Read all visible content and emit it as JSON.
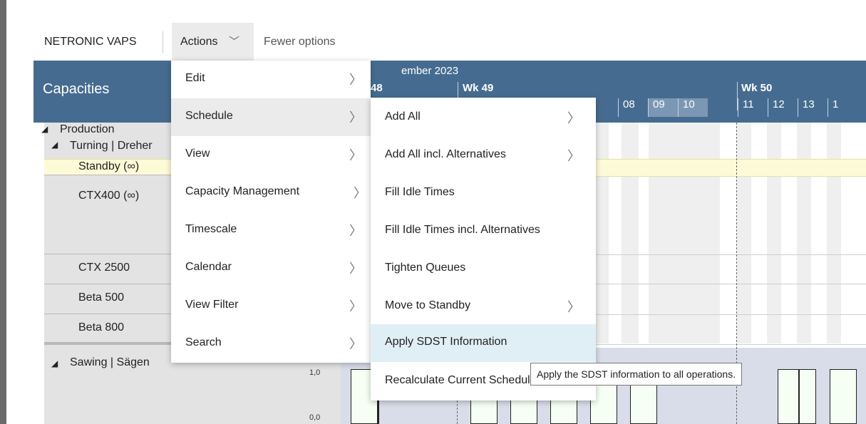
{
  "toolbar": {
    "title": "NETRONIC VAPS",
    "actions_label": "Actions",
    "fewer_options": "Fewer options"
  },
  "header": {
    "capacities": "Capacities",
    "month": "ember 2023",
    "weeks": [
      "48",
      "Wk 49",
      "Wk 50"
    ],
    "days": [
      "08",
      "09",
      "10",
      "11",
      "12",
      "13",
      "1"
    ]
  },
  "resources": {
    "production": "Production",
    "turning": "Turning | Dreher",
    "standby": "Standby (∞)",
    "ctx400": "CTX400 (∞)",
    "ctx2500": "CTX 2500",
    "beta500": "Beta 500",
    "beta800": "Beta 800",
    "sawing": "Sawing | Sägen"
  },
  "axis": {
    "top": "1,0",
    "bottom": "0,0"
  },
  "actions_menu": {
    "items": [
      {
        "label": "Edit"
      },
      {
        "label": "Schedule"
      },
      {
        "label": "View"
      },
      {
        "label": "Capacity Management"
      },
      {
        "label": "Timescale"
      },
      {
        "label": "Calendar"
      },
      {
        "label": "View Filter"
      },
      {
        "label": "Search"
      }
    ]
  },
  "schedule_menu": {
    "items": [
      {
        "label": "Add All"
      },
      {
        "label": "Add All incl. Alternatives"
      },
      {
        "label": "Fill Idle Times"
      },
      {
        "label": "Fill Idle Times incl. Alternatives"
      },
      {
        "label": "Tighten Queues"
      },
      {
        "label": "Move to Standby"
      },
      {
        "label": "Apply SDST Information"
      },
      {
        "label": "Recalculate Current Schedule"
      }
    ]
  },
  "tooltip": "Apply the SDST information to all operations.",
  "colors": {
    "header_bg": "#456c90",
    "standby_band": "#fdfbd7",
    "menu_hover": "#e0eff5",
    "bar_fill": "#f6fff3"
  },
  "icons": {
    "expand": "triangle-down-icon",
    "submenu": "chevron-right-icon",
    "dropdown": "chevron-down-icon"
  }
}
